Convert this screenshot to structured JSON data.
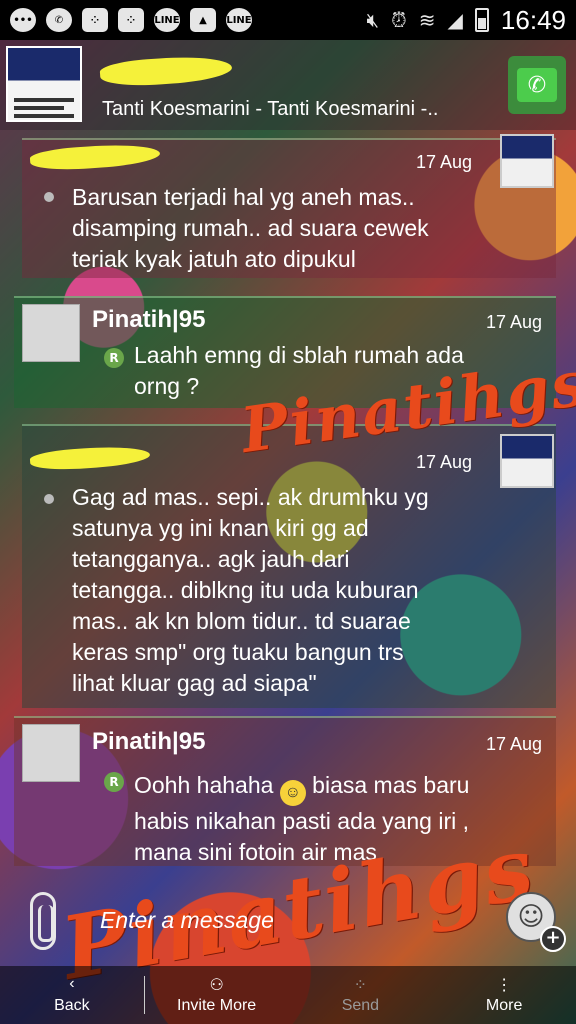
{
  "status_bar": {
    "time": "16:49",
    "notification_icons": [
      "chat-icon",
      "whatsapp-icon",
      "bbm-icon",
      "bbm-icon",
      "line-icon",
      "gallery-icon",
      "line-icon"
    ],
    "system_icons": [
      "mute-icon",
      "alarm-icon",
      "wifi-icon",
      "signal-icon",
      "battery-icon"
    ],
    "line_label": "LINE"
  },
  "header": {
    "subtitle": "Tanti Koesmarini - Tanti Koesmarini -.."
  },
  "messages": [
    {
      "sender": "",
      "date": "17 Aug",
      "text": "Barusan terjadi hal yg aneh mas..\ndisamping rumah.. ad suara cewek\nteriak kyak jatuh ato dipukul"
    },
    {
      "sender": "Pinatih|95",
      "date": "17 Aug",
      "badge": "R",
      "text": "Laahh emng di sblah rumah ada\norng ?"
    },
    {
      "sender": "",
      "date": "17 Aug",
      "text": "Gag ad mas.. sepi.. ak drumhku yg\nsatunya yg ini knan kiri gg ad\ntetangganya.. agk jauh dari\ntetangga.. diblkng itu uda kuburan\nmas.. ak kn blom tidur.. td suarae\nkeras smp\" org tuaku bangun trs\nlihat kluar gag ad siapa\""
    },
    {
      "sender": "Pinatih|95",
      "date": "17 Aug",
      "badge": "R",
      "text_before": "Oohh hahaha",
      "text_after": " biasa mas baru\nhabis nikahan pasti ada yang iri ,\nmana sini fotoin air mas"
    }
  ],
  "watermark": "Pinatihgs",
  "input": {
    "placeholder": "Enter a message"
  },
  "bottom_bar": {
    "back": "Back",
    "invite_more": "Invite More",
    "send": "Send",
    "more": "More"
  }
}
